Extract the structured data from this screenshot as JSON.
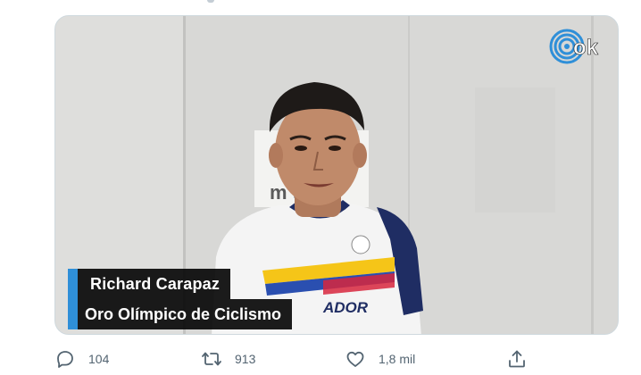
{
  "tweet": {
    "video": {
      "brand_logo_text": "ok",
      "background_sign_text": "m   t",
      "jersey_text": "ADOR",
      "lower_third": {
        "name": "Richard Carapaz",
        "title": "Oro Olímpico de Ciclismo"
      }
    },
    "actions": {
      "reply": {
        "icon": "reply-icon",
        "count": "104"
      },
      "retweet": {
        "icon": "retweet-icon",
        "count": "913"
      },
      "like": {
        "icon": "heart-icon",
        "count": "1,8 mil"
      },
      "share": {
        "icon": "share-icon"
      }
    },
    "colors": {
      "accent_blue": "#2f8fd8",
      "action_gray": "#536471",
      "media_border": "#cfd9de"
    }
  }
}
